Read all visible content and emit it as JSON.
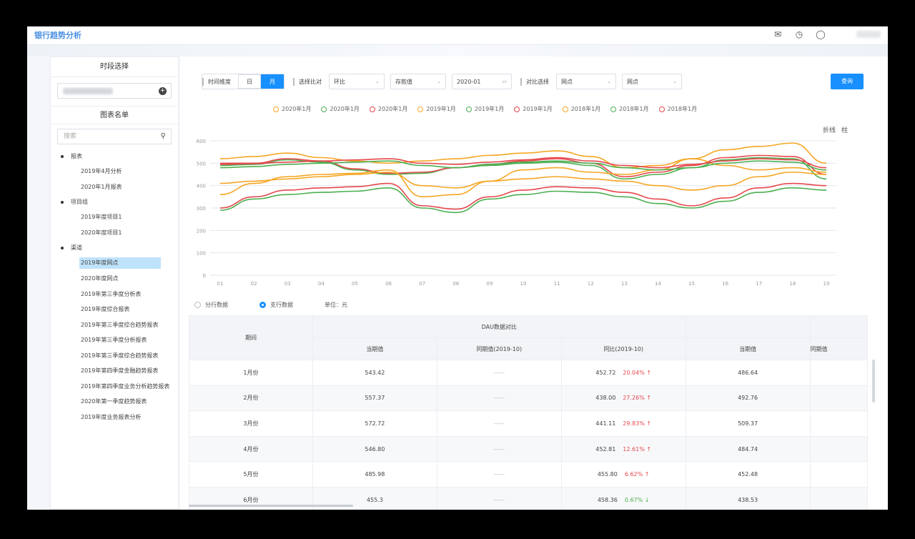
{
  "app": {
    "title": "银行趋势分析"
  },
  "topbar": {
    "icons": [
      "message-icon",
      "clock-icon",
      "bell-icon"
    ]
  },
  "sidebar": {
    "header1": "时段选择",
    "header2": "图表名单",
    "search_placeholder": "搜索",
    "groups": [
      {
        "label": "报表",
        "items": [
          "2019年4月分析",
          "2020年1月报表"
        ]
      },
      {
        "label": "项目组",
        "items": [
          "2019年度项目1",
          "2020年度项目1"
        ]
      },
      {
        "label": "渠道",
        "items": [
          "2019年度网点",
          "2020年度网点",
          "2019年第三季度分析表",
          "2019年度综合报表",
          "2019年第三季度综合趋势报表",
          "2019年第三季度分析报表",
          "2019年第三季度综合趋势报表",
          "2019年第四季度金融趋势报表",
          "2019年第四季度业务分析趋势报表",
          "2020年第一季度趋势报表",
          "2019年度业务报表分析"
        ]
      }
    ],
    "active_item": "2019年度网点"
  },
  "filters": {
    "period_label": "时间维度",
    "period_options": [
      "日",
      "月"
    ],
    "period_selected": "月",
    "compare_label": "选择比对",
    "compare_value": "环比",
    "metric_value": "存款值",
    "date_value": "2020-01",
    "range_label": "对比选择",
    "range_start": "网点",
    "range_end": "网点",
    "query_label": "查询"
  },
  "chart_data": {
    "type": "line",
    "x": [
      "01",
      "02",
      "03",
      "04",
      "05",
      "06",
      "07",
      "08",
      "09",
      "10",
      "11",
      "12",
      "13",
      "14",
      "15",
      "16",
      "17",
      "18",
      "19"
    ],
    "ylim": [
      0,
      600
    ],
    "yticks": [
      "600",
      "500",
      "400",
      "300",
      "200",
      "100",
      "0"
    ],
    "series": [
      {
        "name": "2020年1月",
        "color": "#f5a623",
        "values": [
          520,
          530,
          545,
          525,
          510,
          500,
          510,
          520,
          535,
          545,
          555,
          530,
          480,
          490,
          520,
          560,
          575,
          590,
          500
        ]
      },
      {
        "name": "2020年1月",
        "color": "#4caf50",
        "values": [
          490,
          495,
          515,
          505,
          470,
          450,
          455,
          480,
          490,
          500,
          505,
          490,
          430,
          450,
          480,
          515,
          525,
          520,
          430
        ]
      },
      {
        "name": "2020年1月",
        "color": "#e5484d",
        "values": [
          500,
          500,
          520,
          510,
          475,
          455,
          460,
          480,
          495,
          510,
          520,
          500,
          440,
          460,
          490,
          525,
          535,
          530,
          450
        ]
      },
      {
        "name": "2019年1月",
        "color": "#f5a623",
        "values": [
          360,
          410,
          440,
          450,
          455,
          470,
          350,
          360,
          420,
          470,
          480,
          460,
          450,
          470,
          520,
          490,
          470,
          480,
          460
        ]
      },
      {
        "name": "2019年1月",
        "color": "#4caf50",
        "values": [
          290,
          340,
          360,
          370,
          375,
          390,
          300,
          280,
          340,
          360,
          375,
          370,
          350,
          320,
          300,
          330,
          370,
          390,
          380
        ]
      },
      {
        "name": "2019年1月",
        "color": "#e5484d",
        "values": [
          300,
          350,
          380,
          390,
          395,
          410,
          310,
          295,
          350,
          380,
          395,
          390,
          370,
          340,
          310,
          345,
          390,
          410,
          400
        ]
      },
      {
        "name": "2018年1月",
        "color": "#f5a623",
        "values": [
          410,
          420,
          430,
          440,
          450,
          460,
          400,
          390,
          420,
          430,
          440,
          430,
          420,
          400,
          380,
          400,
          440,
          460,
          450
        ]
      },
      {
        "name": "2018年1月",
        "color": "#4caf50",
        "values": [
          480,
          485,
          495,
          500,
          505,
          510,
          490,
          480,
          495,
          505,
          510,
          500,
          480,
          470,
          480,
          500,
          510,
          505,
          470
        ]
      },
      {
        "name": "2018年1月",
        "color": "#e5484d",
        "values": [
          495,
          498,
          505,
          510,
          515,
          520,
          500,
          495,
          505,
          515,
          525,
          510,
          490,
          480,
          495,
          510,
          520,
          515,
          480
        ]
      }
    ]
  },
  "chart_tools": [
    "折线",
    "柱"
  ],
  "radios": {
    "opt1": "分行数据",
    "opt2": "支行数据",
    "unit": "单位：元"
  },
  "table": {
    "col_period": "期间",
    "group1": "DAU数据对比",
    "sub1": "当期值",
    "sub2": "同期值(2019-10)",
    "sub3": "同比(2019-10)",
    "group2_sub": "当期值",
    "extra_head": "同期值",
    "rows": [
      {
        "period": "1月份",
        "v1": "543.42",
        "v2": "——",
        "v3": "452.72",
        "pct": "20.04% ↑",
        "dir": "up",
        "v4": "486.64"
      },
      {
        "period": "2月份",
        "v1": "557.37",
        "v2": "——",
        "v3": "438.00",
        "pct": "27.26% ↑",
        "dir": "up",
        "v4": "492.76"
      },
      {
        "period": "3月份",
        "v1": "572.72",
        "v2": "——",
        "v3": "441.11",
        "pct": "29.83% ↑",
        "dir": "up",
        "v4": "509.37"
      },
      {
        "period": "4月份",
        "v1": "546.80",
        "v2": "——",
        "v3": "452.81",
        "pct": "12.61% ↑",
        "dir": "up",
        "v4": "484.74"
      },
      {
        "period": "5月份",
        "v1": "485.98",
        "v2": "——",
        "v3": "455.80",
        "pct": "6.62% ↑",
        "dir": "up",
        "v4": "452.48"
      },
      {
        "period": "6月份",
        "v1": "455.3",
        "v2": "——",
        "v3": "458.36",
        "pct": "0.67% ↓",
        "dir": "dn",
        "v4": "438.53"
      }
    ]
  }
}
